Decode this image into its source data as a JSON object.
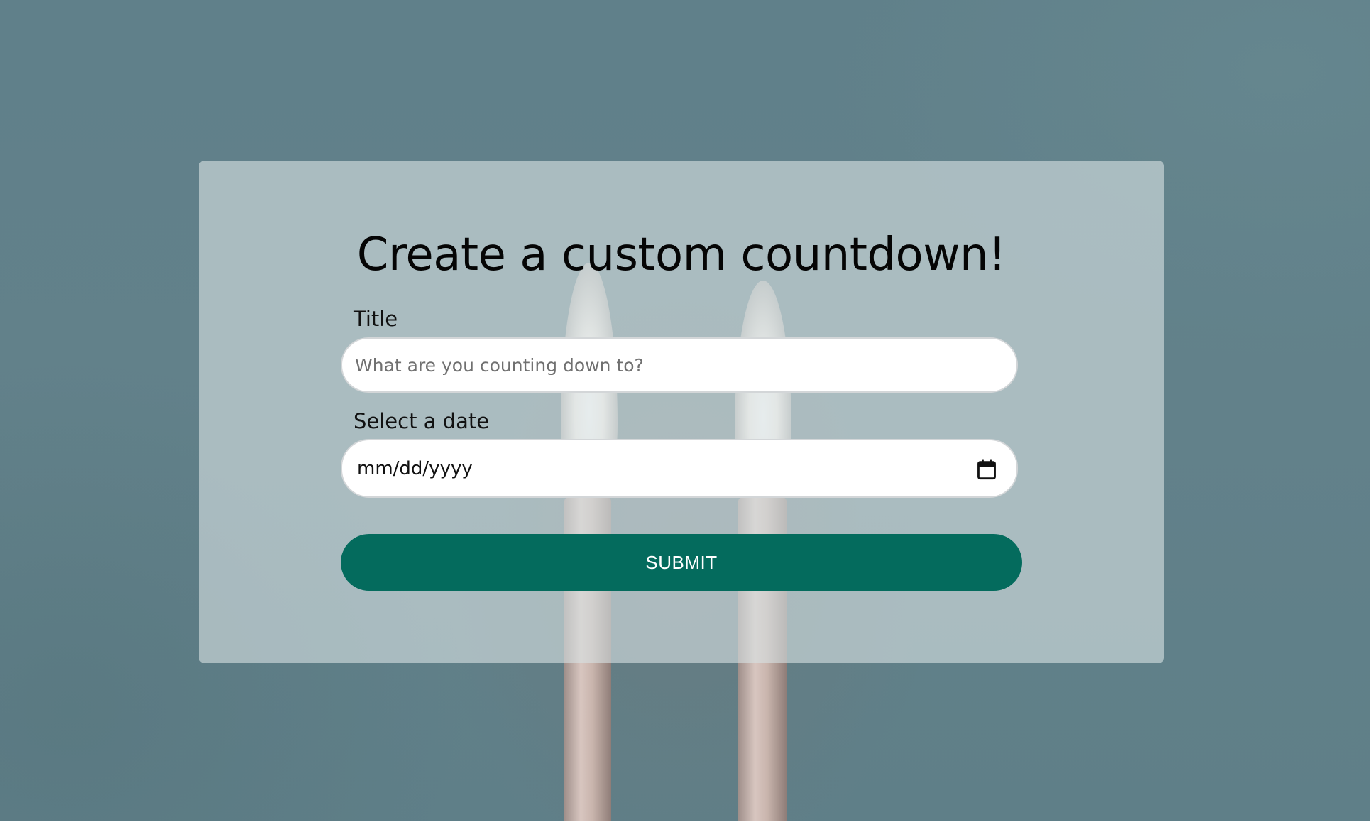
{
  "page": {
    "background_color": "#62808a"
  },
  "form": {
    "heading": "Create a custom countdown!",
    "title_field": {
      "label": "Title",
      "placeholder": "What are you counting down to?",
      "value": ""
    },
    "date_field": {
      "label": "Select a date",
      "display_value": "mm/dd/yyyy",
      "icon": "calendar-icon"
    },
    "submit": {
      "label": "SUBMIT",
      "color": "#046b5d"
    }
  }
}
